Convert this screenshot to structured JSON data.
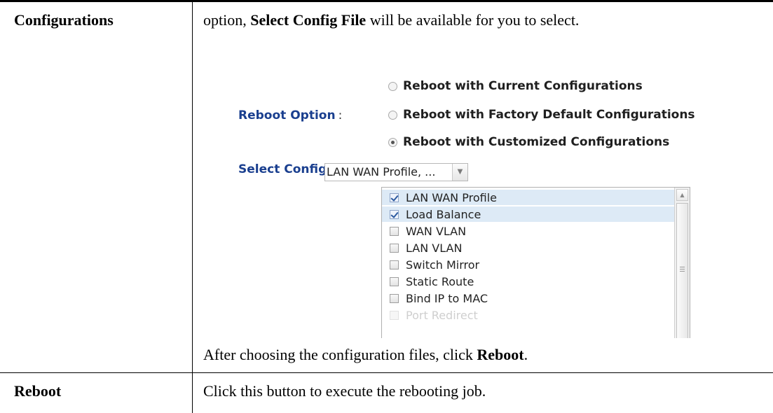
{
  "rows": [
    {
      "term": "Configurations",
      "intro": {
        "pre": "option, ",
        "bold": "Select Config File",
        "post": " will be available for you to select."
      },
      "outro": {
        "pre": "After choosing the configuration files, click ",
        "bold": "Reboot",
        "post": "."
      }
    },
    {
      "term": "Reboot",
      "description": "Click this button to execute the rebooting job."
    }
  ],
  "screenshot": {
    "reboot_option_label": "Reboot Option",
    "colon": ":",
    "options": [
      {
        "label": "Reboot with Current Configurations",
        "checked": false
      },
      {
        "label": "Reboot with Factory Default Configurations",
        "checked": false
      },
      {
        "label": "Reboot with Customized Configurations",
        "checked": true
      }
    ],
    "select_config_label": "Select Config File",
    "select_value": "LAN WAN Profile, ...",
    "dropdown_arrow_icon": "chevron-down-icon",
    "config_files": [
      {
        "label": "LAN WAN Profile",
        "checked": true
      },
      {
        "label": "Load Balance",
        "checked": true
      },
      {
        "label": "WAN VLAN",
        "checked": false
      },
      {
        "label": "LAN VLAN",
        "checked": false
      },
      {
        "label": "Switch Mirror",
        "checked": false
      },
      {
        "label": "Static Route",
        "checked": false
      },
      {
        "label": "Bind IP to MAC",
        "checked": false
      },
      {
        "label": "Port Redirect",
        "checked": false
      }
    ],
    "colors": {
      "label_blue": "#1a3f8f",
      "selected_row": "#ddeaf6"
    }
  }
}
